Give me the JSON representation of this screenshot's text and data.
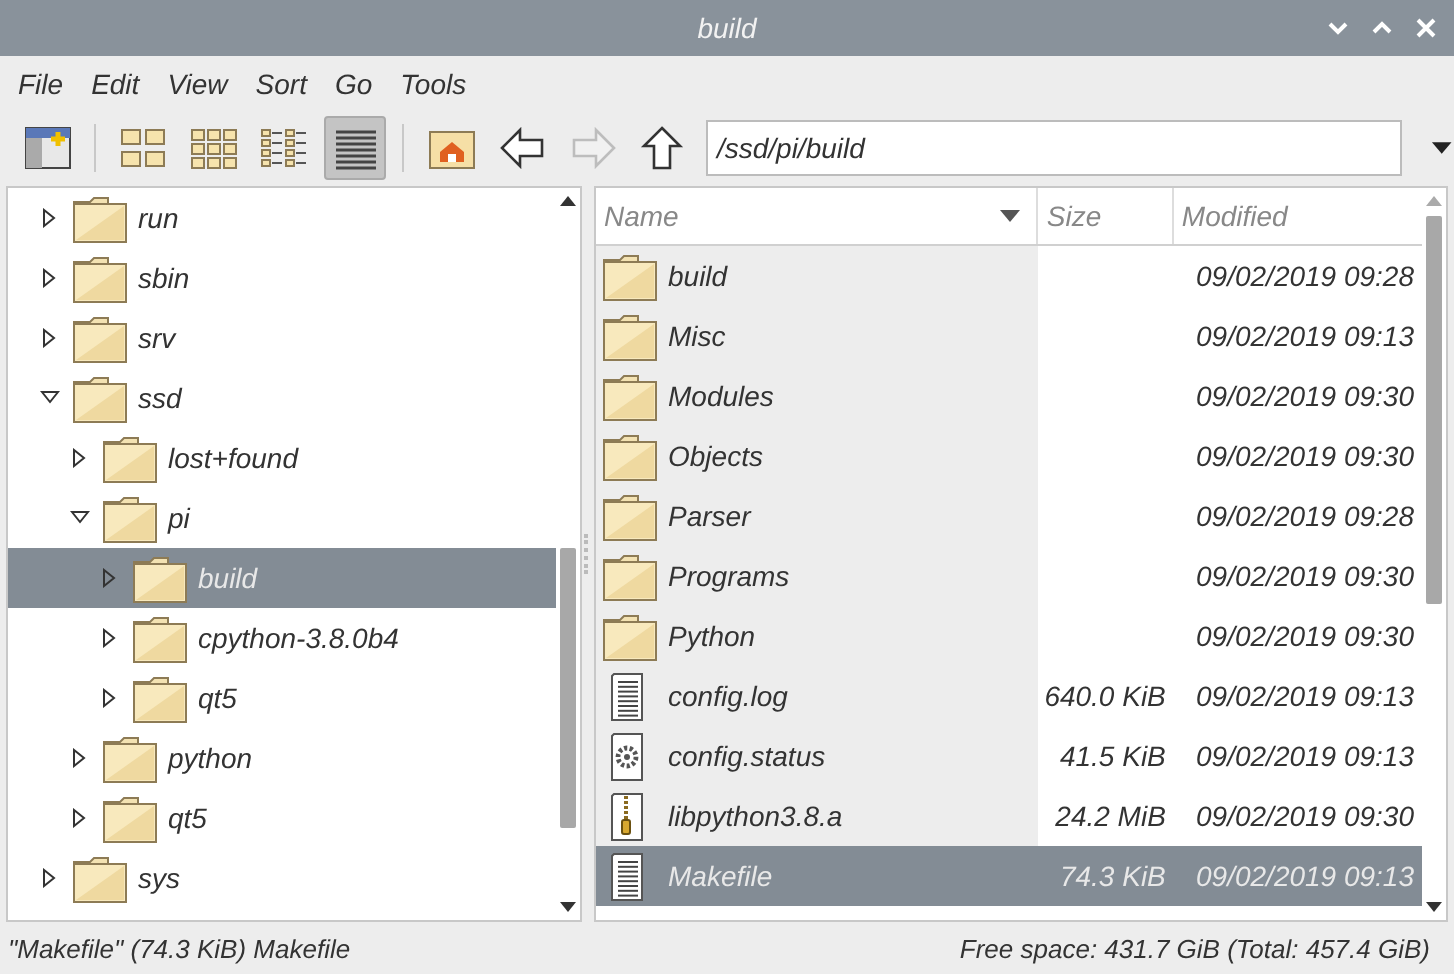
{
  "window": {
    "title": "build"
  },
  "menu": [
    "File",
    "Edit",
    "View",
    "Sort",
    "Go",
    "Tools"
  ],
  "toolbar": {
    "view_modes": [
      {
        "kind": "icons",
        "selected": false
      },
      {
        "kind": "thumbnails",
        "selected": false
      },
      {
        "kind": "compact",
        "selected": false
      },
      {
        "kind": "detailed",
        "selected": true
      }
    ],
    "nav": [
      {
        "kind": "back",
        "disabled": false
      },
      {
        "kind": "forward",
        "disabled": true
      },
      {
        "kind": "up",
        "disabled": false
      }
    ],
    "path": "/ssd/pi/build"
  },
  "tree": [
    {
      "label": "run",
      "expanded": false,
      "selected": false
    },
    {
      "label": "sbin",
      "expanded": false,
      "selected": false
    },
    {
      "label": "srv",
      "expanded": false,
      "selected": false
    },
    {
      "label": "ssd",
      "expanded": true,
      "selected": false,
      "children": [
        {
          "label": "lost+found",
          "expanded": false,
          "selected": false
        },
        {
          "label": "pi",
          "expanded": true,
          "selected": false,
          "children": [
            {
              "label": "build",
              "expanded": false,
              "selected": true
            },
            {
              "label": "cpython-3.8.0b4",
              "expanded": false,
              "selected": false
            },
            {
              "label": "qt5",
              "expanded": false,
              "selected": false
            }
          ]
        },
        {
          "label": "python",
          "expanded": false,
          "selected": false
        },
        {
          "label": "qt5",
          "expanded": false,
          "selected": false
        }
      ]
    },
    {
      "label": "sys",
      "expanded": false,
      "selected": false
    }
  ],
  "table": {
    "columns": [
      "Name",
      "Size",
      "Modified"
    ],
    "rows": [
      {
        "kind": "folder",
        "name": "build",
        "modified": "09/02/2019 09:28",
        "selected": false
      },
      {
        "kind": "folder",
        "name": "Misc",
        "modified": "09/02/2019 09:13",
        "selected": false
      },
      {
        "kind": "folder",
        "name": "Modules",
        "modified": "09/02/2019 09:30",
        "selected": false
      },
      {
        "kind": "folder",
        "name": "Objects",
        "modified": "09/02/2019 09:30",
        "selected": false
      },
      {
        "kind": "folder",
        "name": "Parser",
        "modified": "09/02/2019 09:28",
        "selected": false
      },
      {
        "kind": "folder",
        "name": "Programs",
        "modified": "09/02/2019 09:30",
        "selected": false
      },
      {
        "kind": "folder",
        "name": "Python",
        "modified": "09/02/2019 09:30",
        "selected": false
      },
      {
        "kind": "text",
        "name": "config.log",
        "size": "640.0 KiB",
        "modified": "09/02/2019 09:13",
        "selected": false
      },
      {
        "kind": "script",
        "name": "config.status",
        "size": "41.5 KiB",
        "modified": "09/02/2019 09:13",
        "selected": false
      },
      {
        "kind": "archive",
        "name": "libpython3.8.a",
        "size": "24.2 MiB",
        "modified": "09/02/2019 09:30",
        "selected": false
      },
      {
        "kind": "text",
        "name": "Makefile",
        "size": "74.3 KiB",
        "modified": "09/02/2019 09:13",
        "selected": true
      }
    ]
  },
  "status_bar": {
    "selection": "\"Makefile\" (74.3 KiB) Makefile",
    "free_space": "Free space: 431.7 GiB (Total: 457.4 GiB)"
  }
}
